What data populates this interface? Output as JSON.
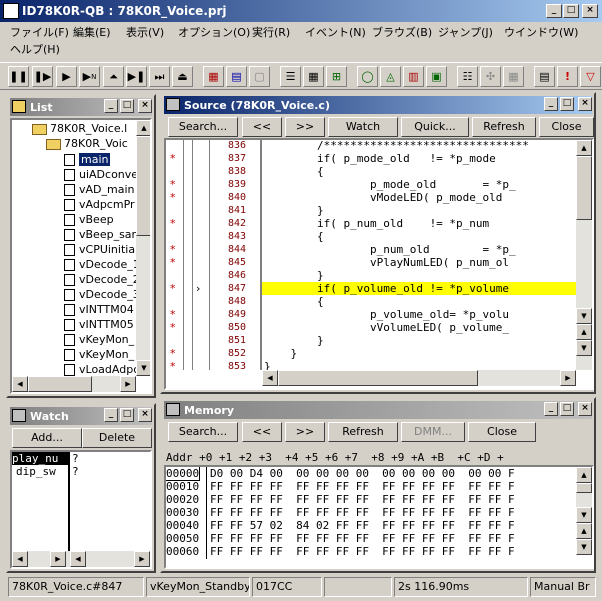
{
  "window": {
    "title": "ID78K0R-QB : 78K0R_Voice.prj"
  },
  "menu": [
    "ファイル(F)",
    "編集(E)",
    "表示(V)",
    "オプション(O)",
    "実行(R)",
    "イベント(N)",
    "ブラウズ(B)",
    "ジャンプ(J)",
    "ウインドウ(W)",
    "ヘルプ(H)"
  ],
  "list": {
    "title": "List",
    "root": "78K0R_Voice.l",
    "project": "78K0R_Voic",
    "items": [
      "main",
      "uiADconve",
      "vAD_main",
      "vAdpcmPr",
      "vBeep",
      "vBeep_sar",
      "vCPUinitial",
      "vDecode_1",
      "vDecode_2",
      "vDecode_3",
      "vINTTM04",
      "vINTTM05",
      "vKeyMon_",
      "vKeyMon_",
      "vLoadAdpc"
    ],
    "selected": "main"
  },
  "watch": {
    "title": "Watch",
    "add": "Add...",
    "delete": "Delete",
    "rows": [
      {
        "name": "play_nu",
        "value": "?"
      },
      {
        "name": "dip_sw",
        "value": "?"
      }
    ]
  },
  "source": {
    "title": "Source (78K0R_Voice.c)",
    "buttons": {
      "search": "Search...",
      "back": "<<",
      "fwd": ">>",
      "watch": "Watch",
      "quick": "Quick...",
      "refresh": "Refresh",
      "close": "Close"
    },
    "lines": [
      {
        "mark": "",
        "num": "836",
        "code": "        /*******************************"
      },
      {
        "mark": "*",
        "num": "837",
        "code": "        if( p_mode_old   != *p_mode"
      },
      {
        "mark": "",
        "num": "838",
        "code": "        {"
      },
      {
        "mark": "*",
        "num": "839",
        "code": "                p_mode_old       = *p_"
      },
      {
        "mark": "*",
        "num": "840",
        "code": "                vModeLED( p_mode_old"
      },
      {
        "mark": "",
        "num": "841",
        "code": "        }"
      },
      {
        "mark": "*",
        "num": "842",
        "code": "        if( p_num_old    != *p_num"
      },
      {
        "mark": "",
        "num": "843",
        "code": "        {"
      },
      {
        "mark": "*",
        "num": "844",
        "code": "                p_num_old        = *p_"
      },
      {
        "mark": "*",
        "num": "845",
        "code": "                vPlayNumLED( p_num_ol"
      },
      {
        "mark": "",
        "num": "846",
        "code": "        }"
      },
      {
        "mark": "*",
        "num": "847",
        "code": "        if( p_volume_old != *p_volume"
      },
      {
        "mark": "",
        "num": "848",
        "code": "        {"
      },
      {
        "mark": "*",
        "num": "849",
        "code": "                p_volume_old= *p_volu"
      },
      {
        "mark": "*",
        "num": "850",
        "code": "                vVolumeLED( p_volume_"
      },
      {
        "mark": "",
        "num": "851",
        "code": "        }"
      },
      {
        "mark": "*",
        "num": "852",
        "code": "    }"
      },
      {
        "mark": "*",
        "num": "853",
        "code": "}"
      }
    ],
    "highlight_line": "847",
    "highlight_color": "#ffff00"
  },
  "memory": {
    "title": "Memory",
    "buttons": {
      "search": "Search...",
      "back": "<<",
      "fwd": ">>",
      "refresh": "Refresh",
      "dmm": "DMM...",
      "close": "Close"
    },
    "header": "Addr +0 +1 +2 +3  +4 +5 +6 +7  +8 +9 +A +B  +C +D +",
    "rows": [
      {
        "addr": "00000",
        "data": "D0 00 D4 00  00 00 00 00  00 00 00 00  00 00 F"
      },
      {
        "addr": "00010",
        "data": "FF FF FF FF  FF FF FF FF  FF FF FF FF  FF FF F"
      },
      {
        "addr": "00020",
        "data": "FF FF FF FF  FF FF FF FF  FF FF FF FF  FF FF F"
      },
      {
        "addr": "00030",
        "data": "FF FF FF FF  FF FF FF FF  FF FF FF FF  FF FF F"
      },
      {
        "addr": "00040",
        "data": "FF FF 57 02  84 02 FF FF  FF FF FF FF  FF FF F"
      },
      {
        "addr": "00050",
        "data": "FF FF FF FF  FF FF FF FF  FF FF FF FF  FF FF F"
      },
      {
        "addr": "00060",
        "data": "FF FF FF FF  FF FF FF FF  FF FF FF FF  FF FF F"
      }
    ]
  },
  "status": {
    "location": "78K0R_Voice.c#847",
    "function": "vKeyMon_Standby",
    "pc": "017CC",
    "time": "2s 116.90ms",
    "mode": "Manual Br"
  }
}
